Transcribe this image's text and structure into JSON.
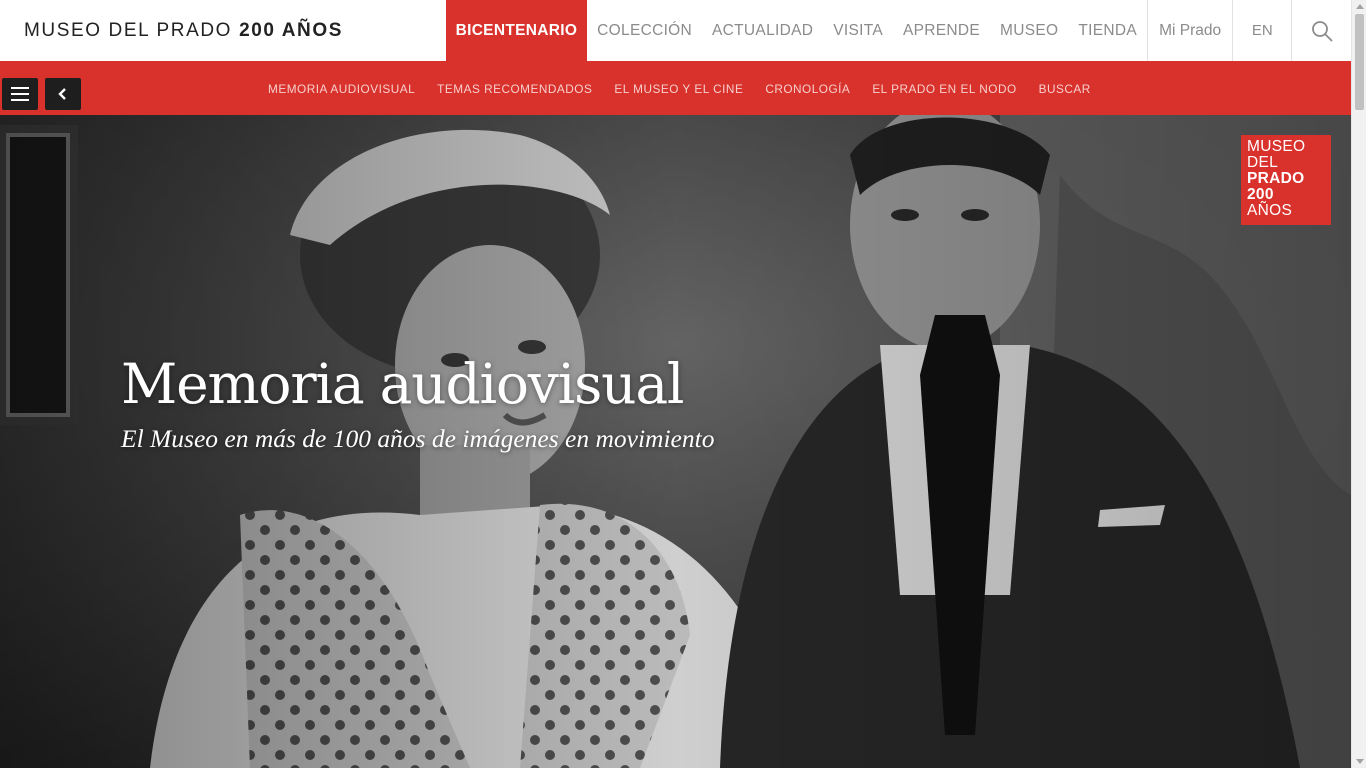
{
  "header": {
    "logo_text": "MUSEO DEL PRADO",
    "logo_bold": "200 AÑOS",
    "nav": [
      {
        "label": "BICENTENARIO",
        "active": true
      },
      {
        "label": "COLECCIÓN",
        "active": false
      },
      {
        "label": "ACTUALIDAD",
        "active": false
      },
      {
        "label": "VISITA",
        "active": false
      },
      {
        "label": "APRENDE",
        "active": false
      },
      {
        "label": "MUSEO",
        "active": false
      },
      {
        "label": "TIENDA",
        "active": false
      }
    ],
    "mi_prado": "Mi Prado",
    "language": "EN",
    "search_icon": "search-icon"
  },
  "subnav": {
    "menu_icon": "hamburger-icon",
    "back_icon": "chevron-left-icon",
    "items": [
      "MEMORIA AUDIOVISUAL",
      "TEMAS RECOMENDADOS",
      "EL MUSEO Y EL CINE",
      "CRONOLOGÍA",
      "EL PRADO EN EL NODO",
      "BUSCAR"
    ]
  },
  "hero": {
    "title": "Memoria audiovisual",
    "subtitle": "El Museo en más de 100 años de imágenes en movimiento",
    "badge": [
      "MUSEO",
      "DEL",
      "PRADO",
      "200",
      "AÑOS"
    ]
  },
  "colors": {
    "accent": "#d9312c",
    "header_bg": "#ffffff",
    "nav_text": "#8b8b8b",
    "control_bg": "#1e1e1e"
  }
}
